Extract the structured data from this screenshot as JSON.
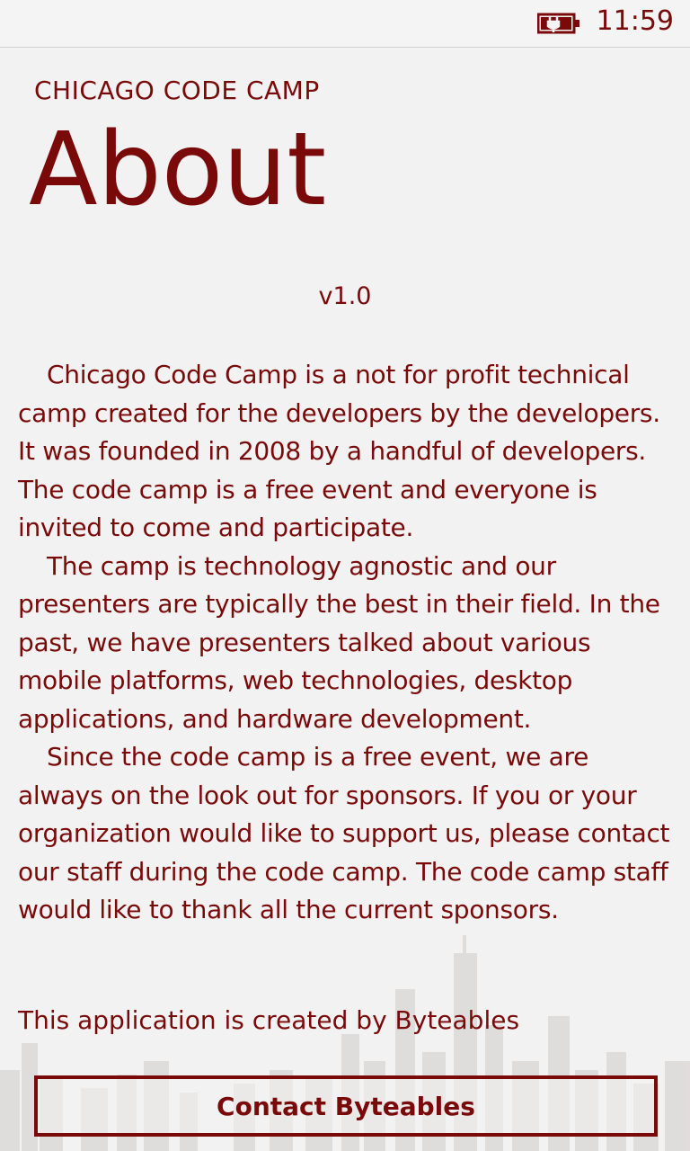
{
  "status_bar": {
    "time": "11:59",
    "battery_icon": "charging-battery-icon",
    "accent": "#7a0a0a"
  },
  "header": {
    "app_title": "CHICAGO CODE CAMP",
    "page_title": "About"
  },
  "about": {
    "version": "v1.0",
    "paragraphs": [
      "Chicago Code Camp is a not for profit technical camp created for the developers by the developers. It was founded in 2008 by a handful of developers. The code camp is a free event and everyone is invited to come and participate.",
      "The camp is technology agnostic and our presenters are typically the best in their field. In the past, we have presenters talked about various mobile platforms, web technologies, desktop applications, and hardware development.",
      "Since the code camp is a free event, we are always on the look out for sponsors. If you or your organization would like to support us, please contact our staff during the code camp. The code camp staff would like to thank all the current sponsors."
    ],
    "credit": "This application is created by Byteables"
  },
  "actions": {
    "contact_label": "Contact Byteables"
  }
}
